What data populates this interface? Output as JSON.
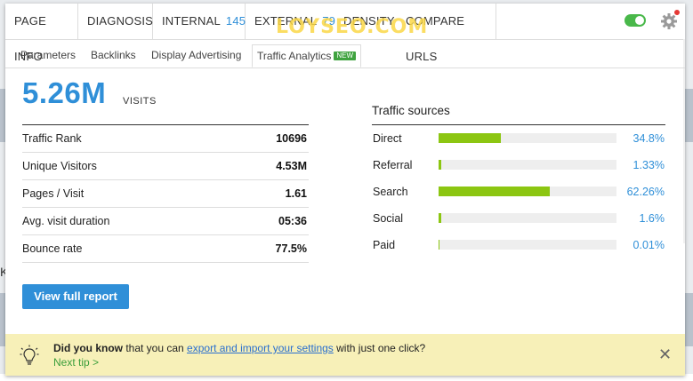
{
  "nav": {
    "tabs": [
      {
        "label": "PAGE INFO"
      },
      {
        "label": "DIAGNOSIS"
      },
      {
        "label": "INTERNAL",
        "count": "145"
      },
      {
        "label": "EXTERNAL",
        "count": "79"
      },
      {
        "label": "DENSITY"
      },
      {
        "label": "COMPARE URLS"
      }
    ],
    "watermark": "LOYSEO.COM",
    "toggle_on": true
  },
  "subtabs": [
    {
      "label": "Parameters"
    },
    {
      "label": "Backlinks"
    },
    {
      "label": "Display Advertising"
    },
    {
      "label": "Traffic Analytics",
      "badge": "NEW"
    }
  ],
  "summary": {
    "visits_value": "5.26M",
    "visits_label": "VISITS"
  },
  "metrics": [
    {
      "label": "Traffic Rank",
      "value": "10696"
    },
    {
      "label": "Unique Visitors",
      "value": "4.53M"
    },
    {
      "label": "Pages / Visit",
      "value": "1.61"
    },
    {
      "label": "Avg. visit duration",
      "value": "05:36"
    },
    {
      "label": "Bounce rate",
      "value": "77.5%"
    }
  ],
  "traffic_sources": {
    "title": "Traffic sources",
    "items": [
      {
        "label": "Direct",
        "percent_text": "34.8%",
        "percent": 34.8
      },
      {
        "label": "Referral",
        "percent_text": "1.33%",
        "percent": 1.33
      },
      {
        "label": "Search",
        "percent_text": "62.26%",
        "percent": 62.26
      },
      {
        "label": "Social",
        "percent_text": "1.6%",
        "percent": 1.6
      },
      {
        "label": "Paid",
        "percent_text": "0.01%",
        "percent": 0.01
      }
    ]
  },
  "report_button": "View full report",
  "tip": {
    "bold": "Did you know",
    "text1": " that you can ",
    "link": "export and import your settings",
    "text2": " with just one click?",
    "next": "Next tip >"
  },
  "background": {
    "left_fragment": "Ko"
  },
  "colors": {
    "accent": "#2f8fd8",
    "bar": "#8cc612",
    "tip_bg": "#f7f0b8",
    "toggle": "#49b84a"
  }
}
